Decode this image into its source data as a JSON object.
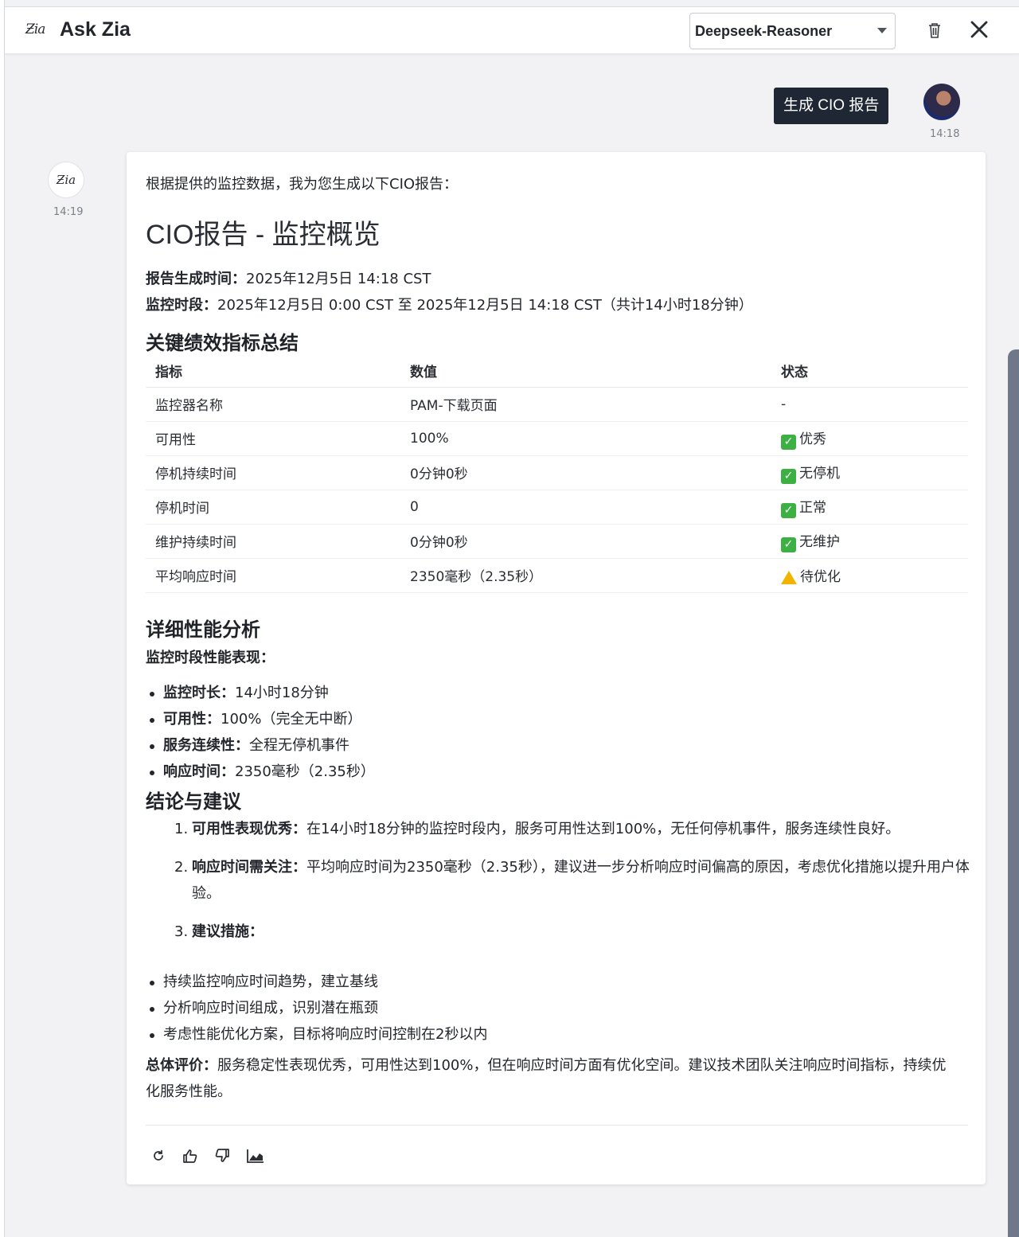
{
  "header": {
    "title": "Ask Zia",
    "model": "Deepseek-Reasoner"
  },
  "user_message": {
    "text": "生成 CIO 报告",
    "time": "14:18"
  },
  "bot_message": {
    "time": "14:19",
    "intro": "根据提供的监控数据，我为您生成以下CIO报告：",
    "report_title": "CIO报告 - 监控概览",
    "generated_label": "报告生成时间：",
    "generated_value": "2025年12月5日 14:18 CST",
    "period_label": "监控时段：",
    "period_value": "2025年12月5日 0:00 CST 至 2025年12月5日 14:18 CST（共计14小时18分钟）",
    "kpi_heading": "关键绩效指标总结",
    "table": {
      "headers": [
        "指标",
        "数值",
        "状态"
      ],
      "rows": [
        {
          "metric": "监控器名称",
          "value": "PAM-下载页面",
          "status": "-",
          "status_type": "none"
        },
        {
          "metric": "可用性",
          "value": "100%",
          "status": "优秀",
          "status_type": "ok"
        },
        {
          "metric": "停机持续时间",
          "value": "0分钟0秒",
          "status": "无停机",
          "status_type": "ok"
        },
        {
          "metric": "停机时间",
          "value": "0",
          "status": "正常",
          "status_type": "ok"
        },
        {
          "metric": "维护持续时间",
          "value": "0分钟0秒",
          "status": "无维护",
          "status_type": "ok"
        },
        {
          "metric": "平均响应时间",
          "value": "2350毫秒（2.35秒）",
          "status": "待优化",
          "status_type": "warn"
        }
      ]
    },
    "analysis_heading": "详细性能分析",
    "analysis_subheading": "监控时段性能表现：",
    "analysis_items": [
      {
        "label": "监控时长：",
        "value": "14小时18分钟"
      },
      {
        "label": "可用性：",
        "value": "100%（完全无中断）"
      },
      {
        "label": "服务连续性：",
        "value": "全程无停机事件"
      },
      {
        "label": "响应时间：",
        "value": "2350毫秒（2.35秒）"
      }
    ],
    "conclusion_heading": "结论与建议",
    "conclusions": [
      {
        "num": "1.",
        "label": "可用性表现优秀：",
        "text": "在14小时18分钟的监控时段内，服务可用性达到100%，无任何停机事件，服务连续性良好。"
      },
      {
        "num": "2.",
        "label": "响应时间需关注：",
        "text": "平均响应时间为2350毫秒（2.35秒），建议进一步分析响应时间偏高的原因，考虑优化措施以提升用户体验。"
      },
      {
        "num": "3.",
        "label": "建议措施：",
        "text": ""
      }
    ],
    "recommendations": [
      "持续监控响应时间趋势，建立基线",
      "分析响应时间组成，识别潜在瓶颈",
      "考虑性能优化方案，目标将响应时间控制在2秒以内"
    ],
    "summary_label": "总体评价：",
    "summary_text": "服务稳定性表现优秀，可用性达到100%，但在响应时间方面有优化空间。建议技术团队关注响应时间指标，持续优化服务性能。"
  },
  "actions": [
    "refresh-icon",
    "thumbs-up-icon",
    "thumbs-down-icon",
    "chart-icon"
  ],
  "colors": {
    "user_bubble": "#1e2733",
    "ok": "#3cb043",
    "warn": "#f2b400",
    "scrollbar": "#6f7888"
  }
}
